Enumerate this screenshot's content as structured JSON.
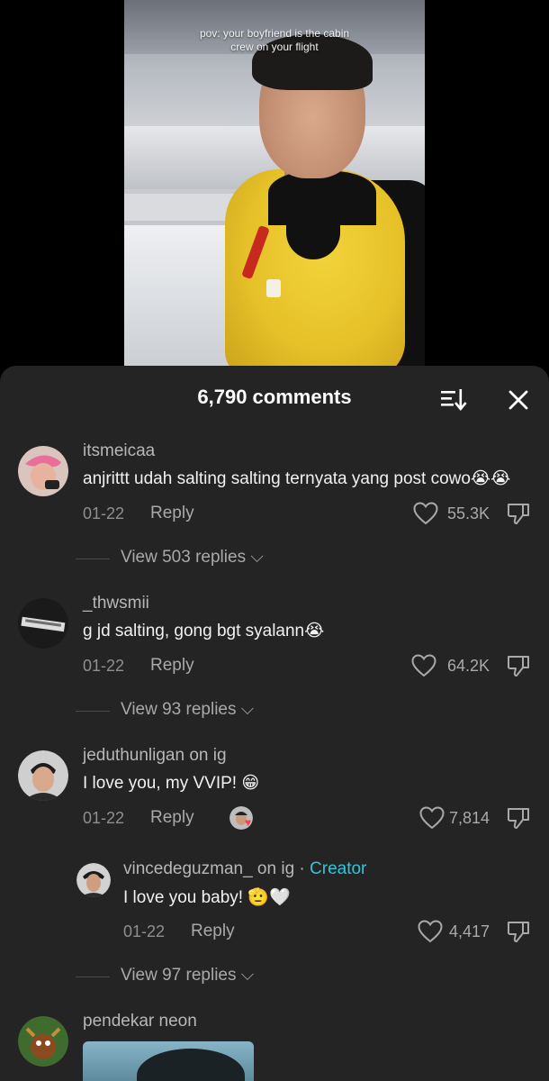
{
  "video": {
    "overlay_line1": "pov: your boyfriend is the cabin",
    "overlay_line2": "crew on your flight"
  },
  "sheet": {
    "count_label": "6,790 comments",
    "sort_icon": "sort-icon",
    "close_icon": "close-icon"
  },
  "comments": [
    {
      "username": "itsmeicaa",
      "text": "anjrittt udah salting salting ternyata yang post cowo😭😭",
      "date": "01-22",
      "reply": "Reply",
      "likes": "55.3K",
      "view_replies": "View 503 replies"
    },
    {
      "username": "_thwsmii",
      "text": "g jd salting, gong bgt syalann😭",
      "date": "01-22",
      "reply": "Reply",
      "likes": "64.2K",
      "view_replies": "View 93 replies"
    },
    {
      "username": "jeduthunligan on ig",
      "text": "I love you, my VVIP! 😁",
      "date": "01-22",
      "reply": "Reply",
      "likes": "7,814",
      "view_replies": "View 97 replies"
    },
    {
      "username": "pendekar neon"
    }
  ],
  "creator_reply": {
    "username": "vincedeguzman_ on ig",
    "separator": " · ",
    "badge": "Creator",
    "text": "I love you baby! 🫡🤍",
    "date": "01-22",
    "reply": "Reply",
    "likes": "4,417"
  },
  "colors": {
    "sheet_bg": "#242424",
    "creator_accent": "#2fc6d9",
    "muted_text": "#a9a9a9"
  }
}
